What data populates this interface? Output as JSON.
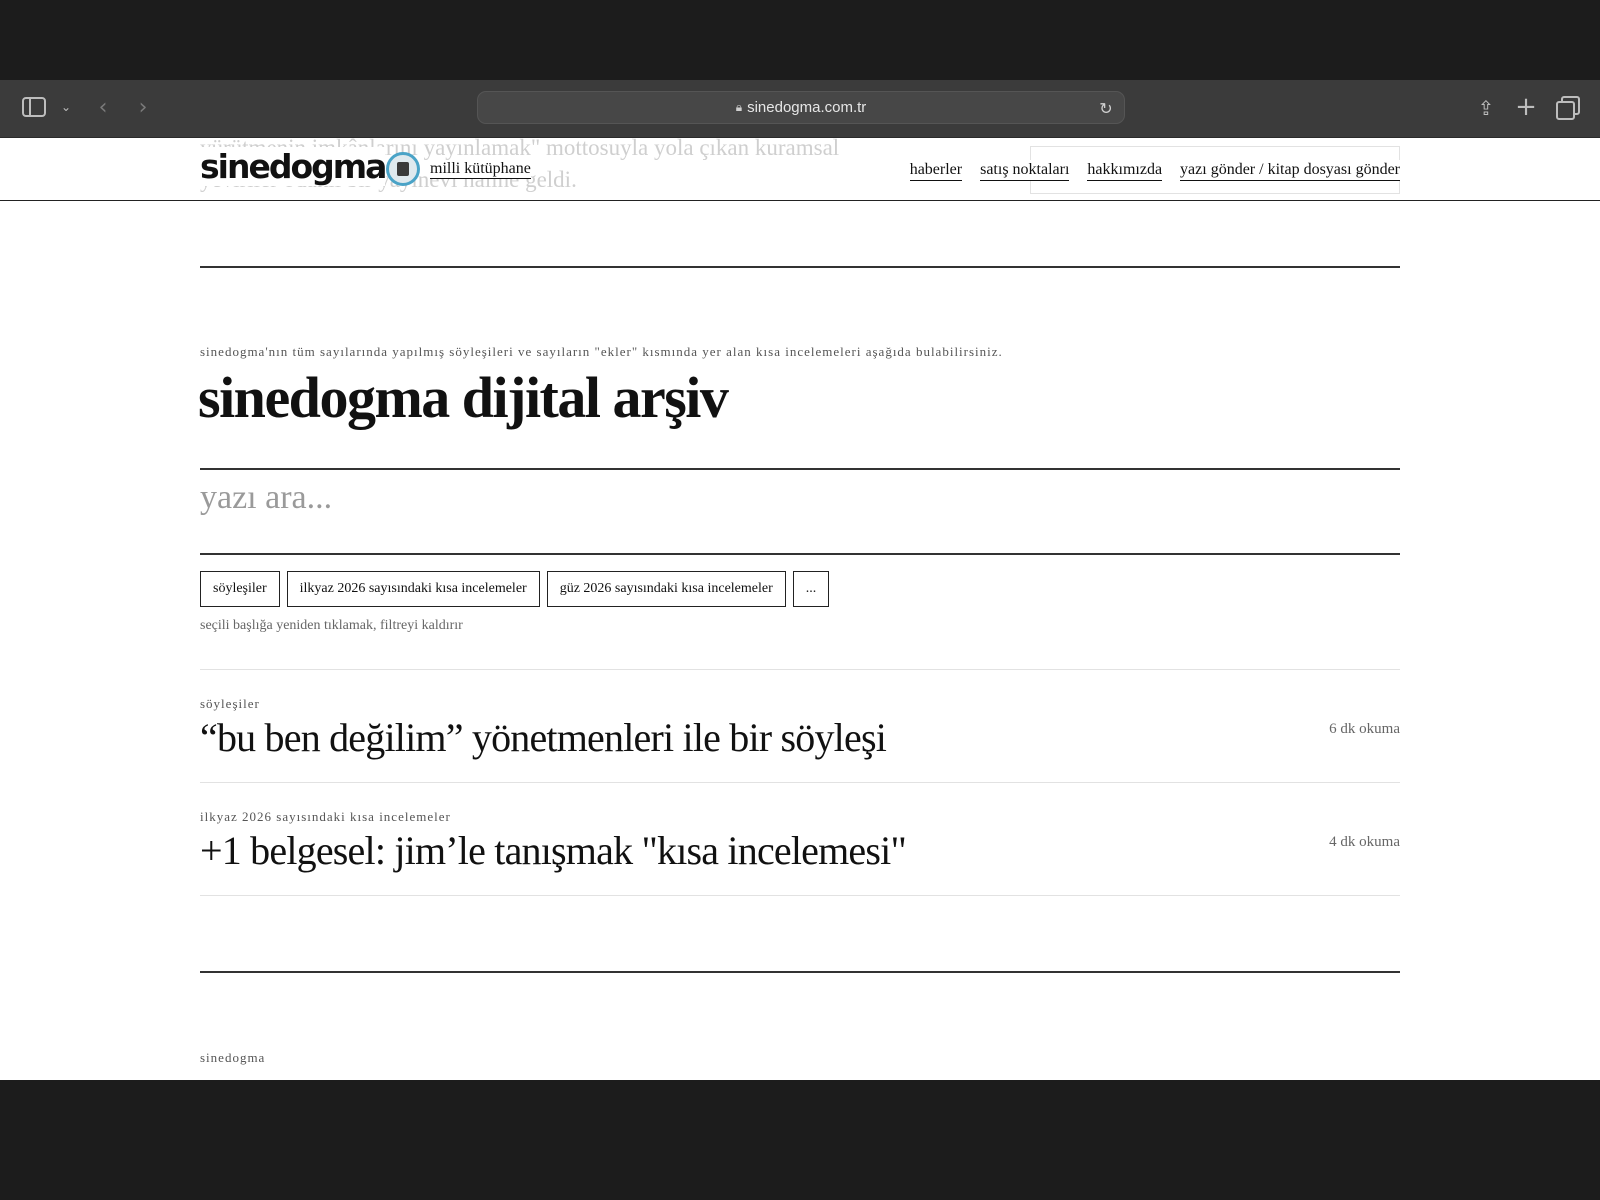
{
  "browser": {
    "url": "sinedogma.com.tr",
    "icons": {
      "sidebar": "sidebar-toggle-icon",
      "caret": "chevron-down-icon",
      "back": "chevron-left-icon",
      "forward": "chevron-right-icon",
      "lock": "lock-icon",
      "reload": "reload-icon",
      "share": "share-icon",
      "new_tab": "plus-icon",
      "tabs": "tab-overview-icon"
    }
  },
  "header": {
    "logo": "sinedogma",
    "milli_kutuphane": "milli kütüphane",
    "ghost_text": "yürütmenin imkânlarını yayınlamak\" mottosuyla yola çıkan kuramsal yeviriler odaklı bir yayınevi hâline geldi.",
    "nav": {
      "haberler": "haberler",
      "satis": "satış noktaları",
      "hakkimizda": "hakkımızda",
      "yazi_gonder": "yazı gönder / kitap dosyası gönder"
    }
  },
  "main": {
    "intro": "sinedogma'nın tüm sayılarında yapılmış söyleşileri ve sayıların \"ekler\" kısmında yer alan kısa incelemeleri aşağıda bulabilirsiniz.",
    "title": "sinedogma dijital arşiv",
    "search_placeholder": "yazı ara...",
    "filters": {
      "soylesiler": "söyleşiler",
      "ilkyaz": "ilkyaz 2026 sayısındaki kısa incelemeler",
      "guz": "güz 2026 sayısındaki kısa incelemeler",
      "more": "..."
    },
    "filter_hint": "seçili başlığa yeniden tıklamak, filtreyi kaldırır"
  },
  "articles": [
    {
      "category": "söyleşiler",
      "title": "“bu ben değilim” yönetmenleri ile bir söyleşi",
      "read_time": "6 dk okuma"
    },
    {
      "category": "ilkyaz 2026 sayısındaki kısa incelemeler",
      "title": "+1 belgesel: jim’le tanışmak \"kısa incelemesi\"",
      "read_time": "4 dk okuma"
    }
  ],
  "footer": {
    "name": "sinedogma"
  }
}
